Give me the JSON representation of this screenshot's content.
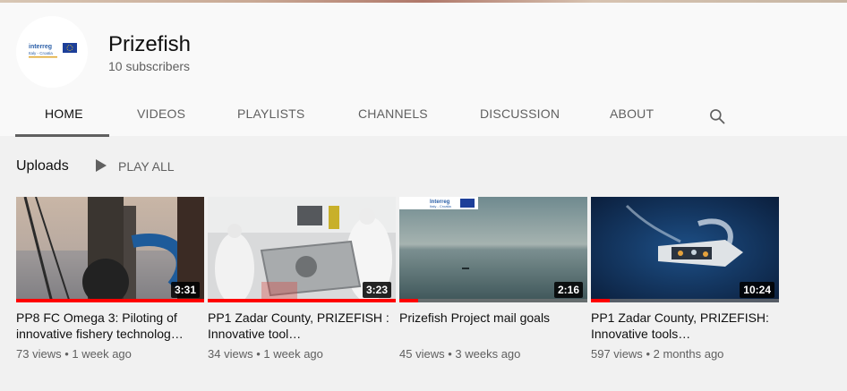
{
  "channel": {
    "name": "Prizefish",
    "subscribers": "10 subscribers",
    "avatar_logo_text": "Interreg Italy - Croatia"
  },
  "tabs": [
    {
      "label": "HOME",
      "active": true
    },
    {
      "label": "VIDEOS"
    },
    {
      "label": "PLAYLISTS"
    },
    {
      "label": "CHANNELS"
    },
    {
      "label": "DISCUSSION"
    },
    {
      "label": "ABOUT"
    }
  ],
  "shelf": {
    "title": "Uploads",
    "play_all": "PLAY ALL"
  },
  "videos": [
    {
      "title": "PP8 FC Omega 3: Piloting of innovative fishery technolog…",
      "duration": "3:31",
      "views": "73 views",
      "age": "1 week ago",
      "watched_fraction": 1.0
    },
    {
      "title": "PP1 Zadar County, PRIZEFISH : Innovative tool…",
      "duration": "3:23",
      "views": "34 views",
      "age": "1 week ago",
      "watched_fraction": 1.0
    },
    {
      "title": "Prizefish Project mail goals",
      "duration": "2:16",
      "views": "45 views",
      "age": "3 weeks ago",
      "watched_fraction": 0.1
    },
    {
      "title": "PP1 Zadar County, PRIZEFISH: Innovative tools…",
      "duration": "10:24",
      "views": "597 views",
      "age": "2 months ago",
      "watched_fraction": 0.1
    }
  ],
  "separator": "•",
  "colors": {
    "accent_red": "#ff0000",
    "text_primary": "#0f0f0f",
    "text_secondary": "#606060"
  }
}
